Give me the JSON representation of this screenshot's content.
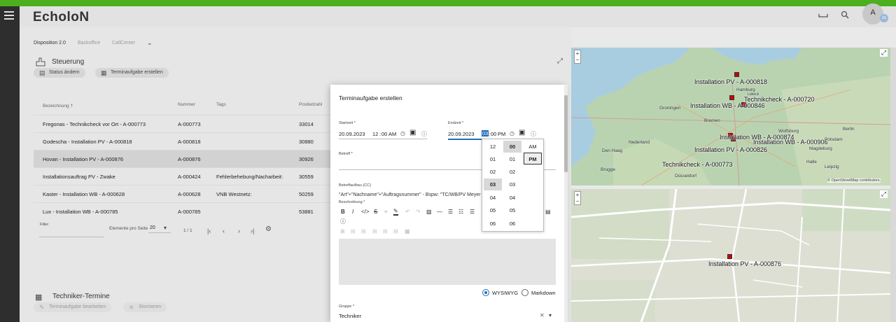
{
  "app": {
    "logo": "EcholoN",
    "avatar_initial": "A",
    "avatar_badge": "JG"
  },
  "tabs": [
    {
      "label": "Disposition 2.0",
      "active": true
    },
    {
      "label": "Backoffice",
      "active": false
    },
    {
      "label": "CallCenter",
      "active": false
    }
  ],
  "steuerung": {
    "title": "Steuerung",
    "btn_status": "Status ändern",
    "btn_create": "Terminaufgabe erstellen"
  },
  "table": {
    "columns": [
      "Bezeichnung",
      "Nummer",
      "Tags",
      "Postleitzahl"
    ],
    "sort_icon": "↑",
    "rows": [
      {
        "name": "Fregonas - Technikcheck vor Ort - A-000773",
        "num": "A-000773",
        "tags": "",
        "plz": "33014",
        "selected": false
      },
      {
        "name": "Godescha - Installation PV - A-000818",
        "num": "A-000818",
        "tags": "",
        "plz": "30880",
        "selected": false
      },
      {
        "name": "Hovan - Installation PV - A-000876",
        "num": "A-000876",
        "tags": "",
        "plz": "30926",
        "selected": true
      },
      {
        "name": "Installationsauftrag PV - Zwake",
        "num": "A-000424",
        "tags": "Fehlerbehebung/Nacharbeit:",
        "plz": "30559",
        "selected": false
      },
      {
        "name": "Kaster - Installation WB - A-000628",
        "num": "A-000628",
        "tags": "VNB Westnetz:",
        "plz": "50259",
        "selected": false
      },
      {
        "name": "Lux - Installation WB - A-000785",
        "num": "A-000785",
        "tags": "",
        "plz": "53881",
        "selected": false
      }
    ],
    "filter_label": "Filter",
    "per_page_label": "Elemente pro Seite",
    "per_page_value": "20",
    "page_info": "1 / 1"
  },
  "techniker": {
    "title": "Techniker-Termine",
    "btn_edit": "Terminaufgabe bearbeiten",
    "btn_cancel": "Stornieren"
  },
  "dialog": {
    "title": "Terminaufgabe erstellen",
    "start_label": "Startzeit *",
    "start_date": "20.09.2023",
    "start_hour": "12",
    "start_min": "00",
    "start_ampm": "AM",
    "end_label": "Endzeit *",
    "end_date": "20.09.2023",
    "end_hour": "03",
    "end_min": "00",
    "end_ampm": "PM",
    "betreff_label": "Betreff *",
    "aufbau_label": "Betreffaufbau (CC)",
    "aufbau_value": "\"Art\"+\"Nachname\"+\"Auftragsnummer\" - Bspw: \"TC/WB/PV Meyer A",
    "beschreibung_label": "Beschreibung *",
    "radio_wysiwyg": "WYSIWYG",
    "radio_markdown": "Markdown",
    "gruppe_label": "Gruppe *",
    "gruppe_value": "Techniker"
  },
  "time_picker": {
    "hours": [
      "12",
      "01",
      "02",
      "03",
      "04",
      "05",
      "06"
    ],
    "minutes": [
      "00",
      "01",
      "02",
      "03",
      "04",
      "05",
      "06"
    ],
    "ampm": [
      "AM",
      "PM"
    ],
    "selected_hour": "03",
    "selected_minute": "00",
    "selected_ampm": "PM"
  },
  "map_top": {
    "markers": [
      {
        "label": "Installation PV - A-000818"
      },
      {
        "label": "Technikcheck - A-000720"
      },
      {
        "label": "Installation WB - A-000846"
      },
      {
        "label": "Installation WB - A-000874"
      },
      {
        "label": "Installation WB - A-000906"
      },
      {
        "label": "Installation PV - A-000826"
      },
      {
        "label": "Technikcheck - A-000773"
      }
    ],
    "cities": [
      "Hamburg",
      "Lübeck",
      "Groningen",
      "Bremen",
      "Berlin",
      "Wolfsburg",
      "Potsdam",
      "Magdeburg",
      "Nederland",
      "Den Haag",
      "Düsseldorf",
      "Brugge",
      "Leipzig",
      "Halle"
    ],
    "attribution": "© OpenStreetMap contributors."
  },
  "map_bottom": {
    "marker_label": "Installation PV - A-000876"
  },
  "colors": {
    "accent_green": "#4caf1d",
    "marker_red": "#cc0000",
    "select_blue": "#1f6fb5"
  }
}
